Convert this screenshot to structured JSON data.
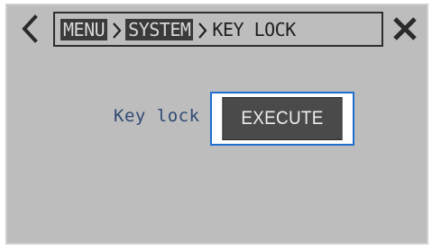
{
  "header": {
    "back_icon": "chevron-left-icon",
    "close_icon": "close-x-icon",
    "breadcrumb": {
      "items": [
        "MENU",
        "SYSTEM"
      ],
      "current": "KEY LOCK",
      "separator_icon": "chevron-right-icon"
    }
  },
  "main": {
    "setting_label": "Key lock",
    "execute_label": "EXECUTE"
  },
  "colors": {
    "screen_bg": "#bdbdbd",
    "breadcrumb_box_bg": "#3a3a3a",
    "label_text": "#2f4a72",
    "focus_border": "#1e6fd0",
    "button_bg": "#4a4a4a"
  }
}
